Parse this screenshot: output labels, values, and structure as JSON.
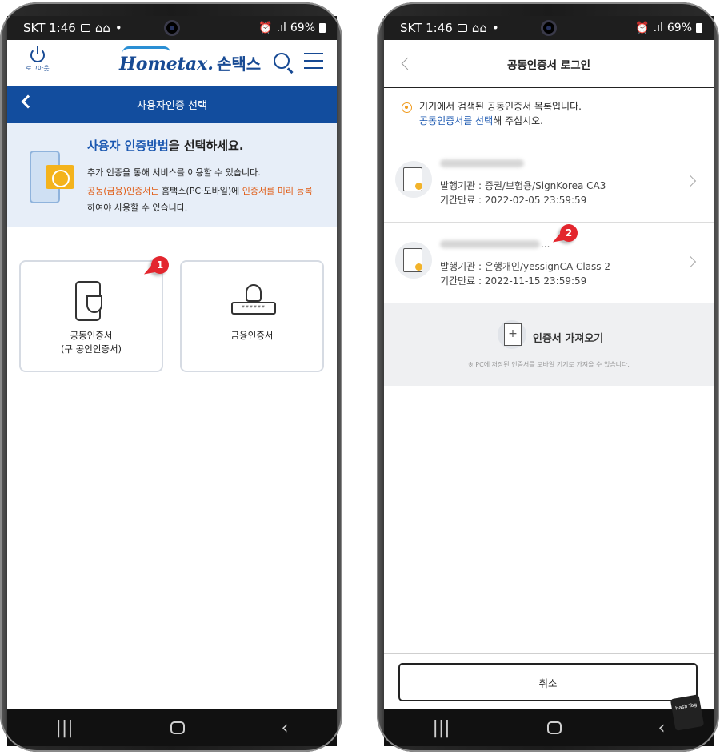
{
  "status": {
    "carrier_time": "SKT 1:46",
    "battery": "69%"
  },
  "left": {
    "logout_label": "로그아웃",
    "brand_en": "Hometax.",
    "brand_ko": "손택스",
    "bar_title": "사용자인증 선택",
    "info_title_hl": "사용자 인증방법",
    "info_title_rest": "을 선택하세요.",
    "info_line1": "추가 인증을 통해 서비스를 이용할 수 있습니다.",
    "info_line2_a": "공동(금융)인증서는",
    "info_line2_b": " 홈택스(PC·모바일)에 ",
    "info_line2_c": "인증서를 미리 등록",
    "info_line3": "하여야 사용할 수 있습니다.",
    "card1_line1": "공동인증서",
    "card1_line2": "(구 공인인증서)",
    "card2_label": "금융인증서",
    "lock_stars": "******",
    "badge": "1"
  },
  "right": {
    "title": "공동인증서 로그인",
    "notice_line1": "기기에서 검색된 공동인증서 목록입니다.",
    "notice_link": "공동인증서를 선택",
    "notice_rest": "해 주십시오.",
    "certs": [
      {
        "issuer": "발행기관 : 증권/보험용/SignKorea CA3",
        "expiry": "기간만료 : 2022-02-05 23:59:59"
      },
      {
        "issuer": "발행기관 : 은행개인/yessignCA Class 2",
        "expiry": "기간만료 : 2022-11-15 23:59:59"
      }
    ],
    "ellipsis": "...",
    "import_title": "인증서 가져오기",
    "import_sub": "※ PC에 저장된 인증서를 모바일 기기로 가져올 수 있습니다.",
    "cancel_label": "취소",
    "badge": "2"
  },
  "nav": {
    "recent": "|||",
    "back": "‹"
  },
  "watermark": "Hash Tag",
  "colors": {
    "brand_blue": "#124d9e",
    "highlight_orange": "#e05a12",
    "badge_red": "#e3262e"
  }
}
